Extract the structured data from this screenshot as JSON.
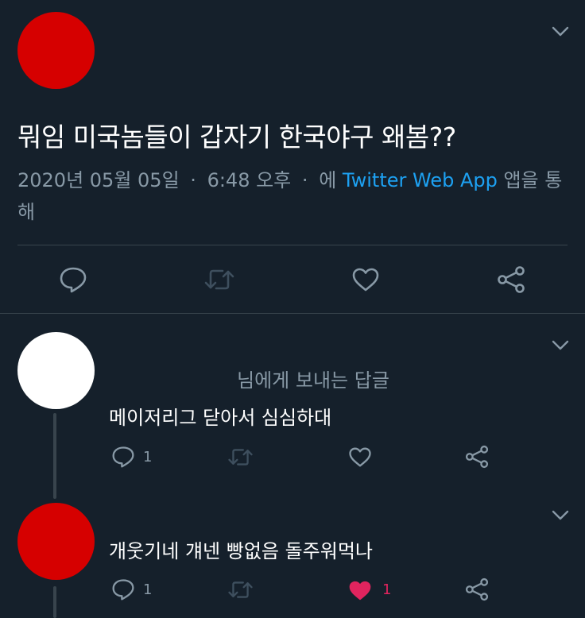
{
  "main_tweet": {
    "avatar_color": "#d60000",
    "text": "뭐임 미국놈들이 갑자기 한국야구 왜봄??",
    "date": "2020년 05월 05일",
    "time": "6:48 오후",
    "via_prefix": "에",
    "via_link": "Twitter Web App",
    "via_suffix": "앱을 통해",
    "sep": "·",
    "actions": [
      "reply-icon",
      "retweet-icon",
      "like-icon",
      "share-icon"
    ]
  },
  "replies": [
    {
      "avatar_color": "#ffffff",
      "reply_to": "님에게 보내는 답글",
      "text": "메이저리그 닫아서 심심하대",
      "reply_count": "1",
      "like_count": "",
      "liked": false
    },
    {
      "avatar_color": "#d60000",
      "text": "개웃기네 걔넨 빵없음 돌주워먹나",
      "reply_count": "1",
      "like_count": "1",
      "liked": true
    }
  ],
  "colors": {
    "background": "#15202b",
    "secondary_text": "#8899a6",
    "link": "#1da1f2",
    "like": "#e0245e",
    "divider": "#38444d"
  }
}
